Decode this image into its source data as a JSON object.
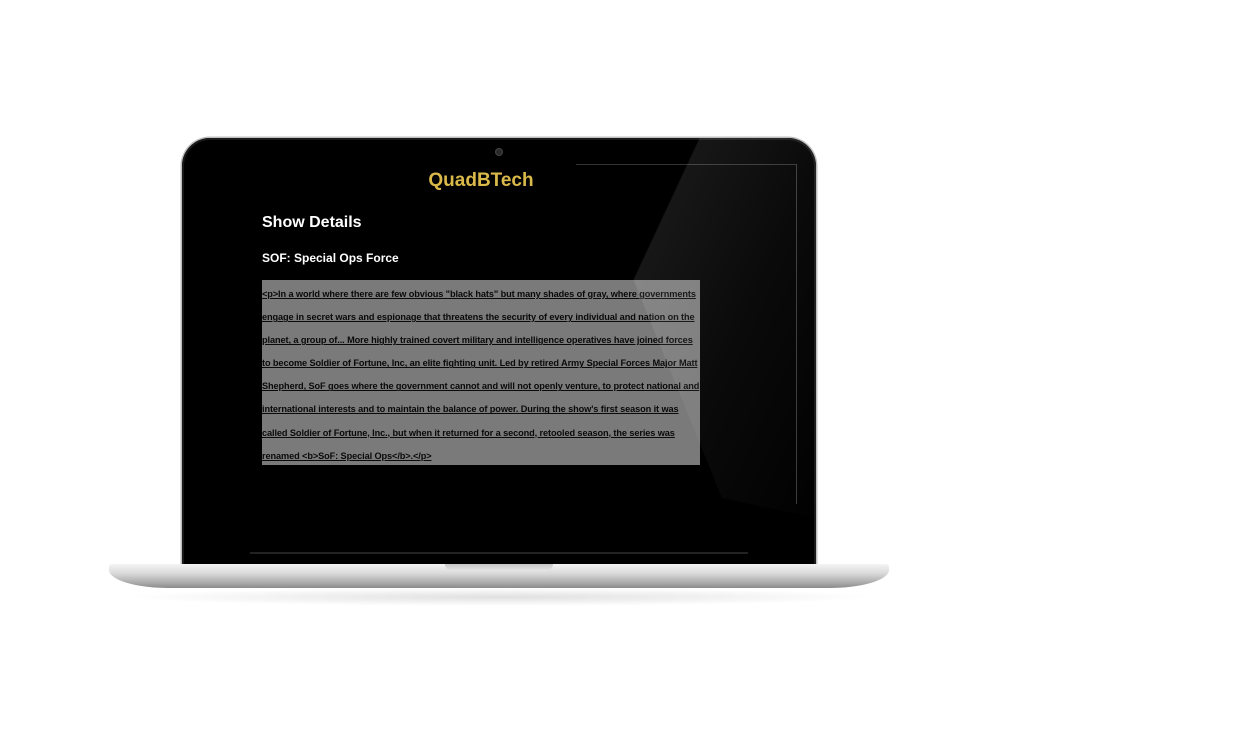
{
  "app": {
    "title": "QuadBTech"
  },
  "page": {
    "heading": "Show Details",
    "show_title": "SOF: Special Ops Force",
    "description": "<p>In a world where there are few obvious \"black hats\" but many shades of gray, where governments engage in secret wars and espionage that threatens the security of every individual and nation on the planet, a group of... More highly trained covert military and intelligence operatives have joined forces to become Soldier of Fortune, Inc, an elite fighting unit. Led by retired Army Special Forces Major Matt Shepherd, SoF goes where the government cannot and will not openly venture, to protect national and international interests and to maintain the balance of power. During the show's first season it was called Soldier of Fortune, Inc., but when it returned for a second, retooled season, the series was renamed <b>SoF: Special Ops</b>.</p>"
  },
  "colors": {
    "accent": "#d9b94a",
    "screen_background": "#000000",
    "description_background": "#7a7a7a"
  },
  "icons": {
    "camera": "camera-icon"
  }
}
